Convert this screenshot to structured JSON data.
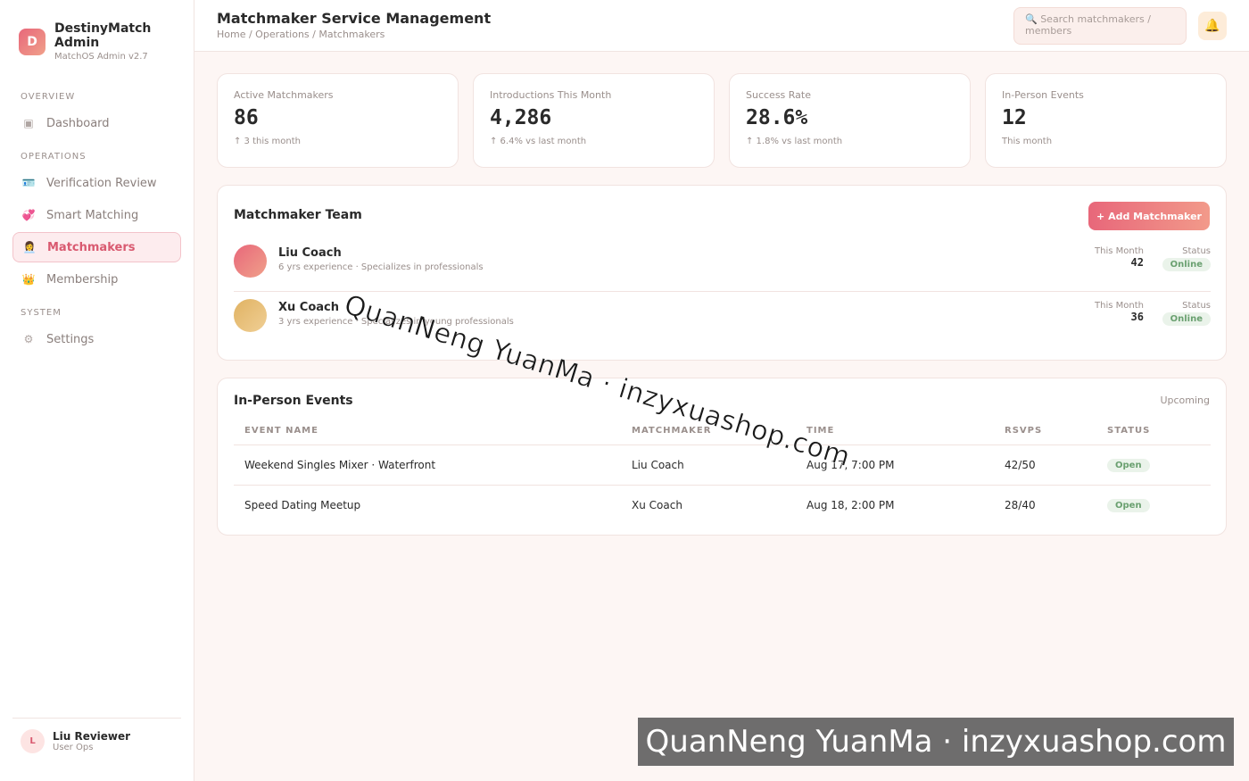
{
  "brand": {
    "logo_letter": "D",
    "name": "DestinyMatch Admin",
    "version": "MatchOS Admin v2.7"
  },
  "nav": {
    "sections": {
      "overview": "OVERVIEW",
      "operations": "OPERATIONS",
      "system": "SYSTEM"
    },
    "items": [
      {
        "label": "Dashboard",
        "icon": "▣"
      },
      {
        "label": "Verification Review",
        "icon": "🪪"
      },
      {
        "label": "Smart Matching",
        "icon": "💞"
      },
      {
        "label": "Matchmakers",
        "icon": "👩‍💼"
      },
      {
        "label": "Membership",
        "icon": "👑"
      },
      {
        "label": "Settings",
        "icon": "⚙"
      }
    ]
  },
  "user": {
    "initial": "L",
    "name": "Liu Reviewer",
    "role": "User Ops"
  },
  "header": {
    "title": "Matchmaker Service Management",
    "breadcrumb": "Home / Operations / Matchmakers",
    "search_placeholder": "🔍 Search matchmakers / members",
    "bell_icon": "🔔"
  },
  "stats": [
    {
      "label": "Active Matchmakers",
      "value": "86",
      "sub": "↑ 3 this month"
    },
    {
      "label": "Introductions This Month",
      "value": "4,286",
      "sub": "↑ 6.4% vs last month"
    },
    {
      "label": "Success Rate",
      "value": "28.6%",
      "sub": "↑ 1.8% vs last month"
    },
    {
      "label": "In-Person Events",
      "value": "12",
      "sub": "This month"
    }
  ],
  "team": {
    "title": "Matchmaker Team",
    "add_label": "+ Add Matchmaker",
    "month_label": "This Month",
    "status_label": "Status",
    "members": [
      {
        "name": "Liu Coach",
        "desc": "6 yrs experience · Specializes in professionals",
        "month": "42",
        "status": "Online",
        "color": "#e8677a"
      },
      {
        "name": "Xu Coach",
        "desc": "3 yrs experience · Specializes in young professionals",
        "month": "36",
        "status": "Online",
        "color": "#e0b262"
      }
    ]
  },
  "events": {
    "title": "In-Person Events",
    "filter": "Upcoming",
    "columns": [
      "EVENT NAME",
      "MATCHMAKER",
      "TIME",
      "RSVPS",
      "STATUS"
    ],
    "rows": [
      {
        "name": "Weekend Singles Mixer · Waterfront",
        "matchmaker": "Liu Coach",
        "time": "Aug 17, 7:00 PM",
        "rsvps": "42/50",
        "status": "Open"
      },
      {
        "name": "Speed Dating Meetup",
        "matchmaker": "Xu Coach",
        "time": "Aug 18, 2:00 PM",
        "rsvps": "28/40",
        "status": "Open"
      }
    ]
  },
  "watermark": "QuanNeng YuanMa · inzyxuashop.com"
}
